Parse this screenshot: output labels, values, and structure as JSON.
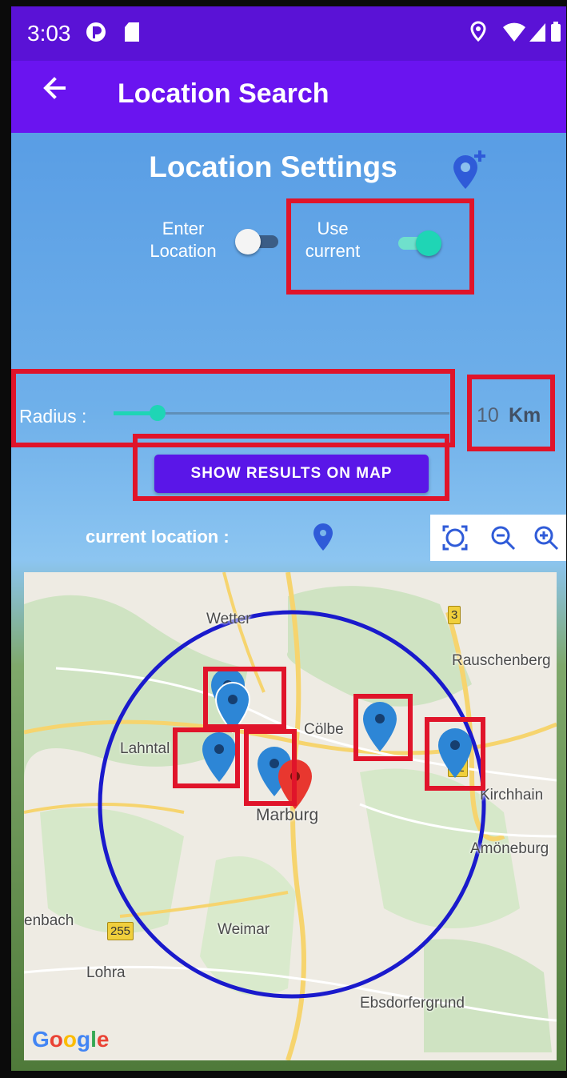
{
  "status_bar": {
    "time": "3:03",
    "icons": [
      "notification-app-icon",
      "sd-card-icon",
      "location-icon",
      "wifi-icon",
      "signal-icon",
      "battery-icon"
    ]
  },
  "app_bar": {
    "title": "Location Search",
    "back_icon": "arrow-back-icon"
  },
  "settings": {
    "title": "Location Settings",
    "add_icon": "add-location-icon",
    "enter_location": {
      "label": "Enter\nLocation",
      "on": false
    },
    "use_current": {
      "label": "Use\ncurrent",
      "on": true
    }
  },
  "radius": {
    "label": "Radius :",
    "value": "10",
    "unit": "Km",
    "slider_fraction": 0.13
  },
  "show_results_button": "SHOW RESULTS ON MAP",
  "current_location": {
    "label": "current location :",
    "icon": "location-pin-icon"
  },
  "zoom_controls": [
    "fit-bounds-icon",
    "zoom-out-icon",
    "zoom-in-icon"
  ],
  "map": {
    "places": [
      "Wetter",
      "Rauschenberg",
      "Cölbe",
      "Lahntal",
      "Marburg",
      "Kirchhain",
      "Amöneburg",
      "enbach",
      "Weimar",
      "Lohra",
      "Ebsdorfergrund"
    ],
    "road_shields": [
      "3",
      "62",
      "255"
    ],
    "attribution": "Google",
    "colors": {
      "circle": "#1a1acc",
      "result_marker": "#2d86d6",
      "current_marker": "#e8372f",
      "highlight_box": "#e0142a"
    }
  },
  "colors": {
    "status_bar": "#5a12d6",
    "app_bar": "#6a14f0",
    "accent": "#1fd5b5",
    "button": "#5a16e8"
  }
}
